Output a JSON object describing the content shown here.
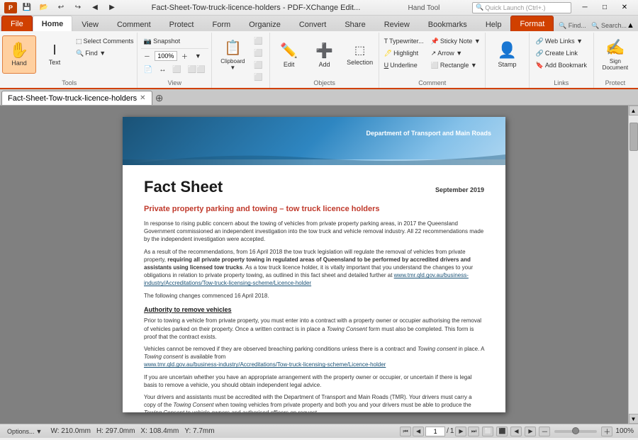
{
  "titlebar": {
    "title": "Fact-Sheet-Tow-truck-licence-holders - PDF-XChange Edit...",
    "tool": "Hand Tool",
    "quicklaunch_placeholder": "Quick Launch (Ctrl+.)",
    "find_label": "Find...",
    "search_label": "Search..."
  },
  "ribbon": {
    "tabs": [
      "File",
      "Home",
      "View",
      "Comment",
      "Protect",
      "Form",
      "Organize",
      "Convert",
      "Share",
      "Review",
      "Bookmarks",
      "Help",
      "Format"
    ],
    "active_tab": "Home",
    "format_active": true,
    "groups": {
      "tools": {
        "label": "Tools",
        "buttons": [
          "Hand",
          "Text",
          "Select Comments",
          "Find ▼"
        ]
      },
      "view": {
        "label": "View",
        "snapshot_label": "Snapshot",
        "zoom_label": "100%",
        "zoom_dropdown": "▼"
      },
      "clipboard": {
        "label": "",
        "clipboard_label": "Clipboard ▼"
      },
      "objects": {
        "label": "Objects",
        "buttons": [
          "Edit",
          "Add",
          "Selection"
        ]
      },
      "comment_group": {
        "label": "Comment",
        "buttons": [
          "Typewriter...",
          "Highlight",
          "Underline",
          "Sticky Note ▼",
          "Arrow ▼",
          "Rectangle ▼"
        ]
      },
      "stamp": {
        "label": "",
        "button": "Stamp"
      },
      "links": {
        "label": "Links",
        "buttons": [
          "Web Links ▼",
          "Create Link",
          "Add Bookmark"
        ]
      },
      "protect": {
        "label": "Protect",
        "button": "Sign Document"
      }
    }
  },
  "document_tab": {
    "name": "Fact-Sheet-Tow-truck-licence-holders",
    "active": true
  },
  "pdf": {
    "dept_name": "Department of Transport and Main Roads",
    "fact_sheet_title": "Fact Sheet",
    "date": "September 2019",
    "subtitle": "Private property parking and towing – tow truck licence holders",
    "paragraphs": [
      "In response to rising public concern about the towing of vehicles from private property parking areas, in 2017 the Queensland Government commissioned an independent investigation into the tow truck and vehicle removal industry. All 22 recommendations made by the independent investigation were accepted.",
      "As a result of the recommendations, from 16 April 2018 the tow truck legislation will regulate the removal of vehicles from private property, requiring all private property towing in regulated areas of Queensland to be performed by accredited drivers and assistants using licensed tow trucks. As a tow truck licence holder, it is vitally important that you understand the changes to your obligations in relation to private property towing, as outlined in this fact sheet and detailed further at www.tmr.qld.gov.au/business-industry/Accreditations/Tow-truck-licensing-scheme/Licence-holder",
      "The following changes commenced 16 April 2018.",
      "Prior to towing a vehicle from private property, you must enter into a contract with a property owner or occupier authorising the removal of vehicles parked on their property. Once a written contract is in place a Towing Consent form must also be completed. This form is proof that the contract exists.",
      "Vehicles cannot be removed if they are observed breaching parking conditions unless there is a contract and Towing consent in place. A Towing consent is available from www.tmr.qld.gov.au/business-industry/Accreditations/Tow-truck-licensing-scheme/Licence-holder",
      "If you are uncertain whether you have an appropriate arrangement with the property owner or occupier, or uncertain if there is legal basis to remove a vehicle, you should obtain independent legal advice.",
      "Your drivers and assistants must be accredited with the Department of Transport and Main Roads (TMR). Your drivers must carry a copy of the Towing Consent when towing vehicles from private property and both you and your drivers must be able to produce the Towing Consent to vehicle owners and authorised officers on request."
    ],
    "authority_heading": "Authority to remove vehicles"
  },
  "status": {
    "options": "Options...",
    "width": "W: 210.0mm",
    "height": "H: 297.0mm",
    "x": "X: 108.4mm",
    "y": "Y: 7.7mm",
    "page_current": "1",
    "page_total": "1",
    "zoom": "100%"
  }
}
